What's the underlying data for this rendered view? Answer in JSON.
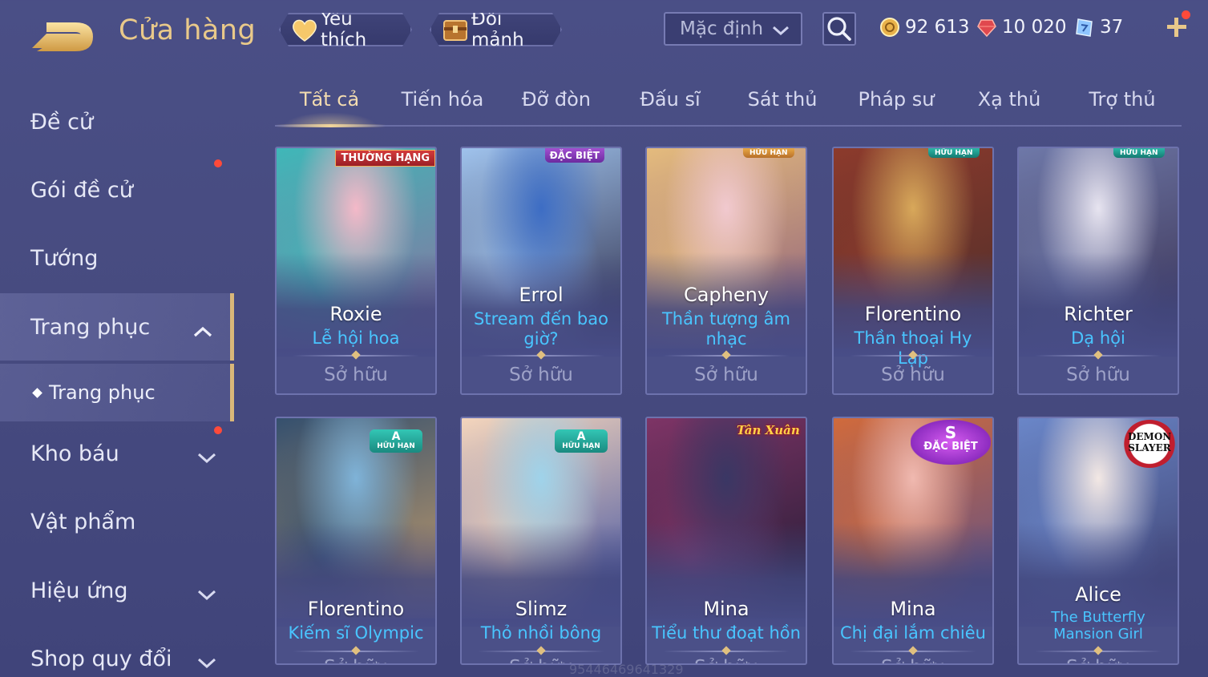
{
  "header": {
    "title": "Cửa hàng",
    "favorites_label": "Yêu thích",
    "fragments_label": "Đổi mảnh",
    "sort_value": "Mặc định",
    "currency": {
      "gold": "92 613",
      "ruby": "10 020",
      "voucher": "37"
    }
  },
  "sidebar": {
    "items": [
      {
        "label": "Đề cử",
        "arrow": "none",
        "badge": false
      },
      {
        "label": "Gói đề cử",
        "arrow": "none",
        "badge": true
      },
      {
        "label": "Tướng",
        "arrow": "none",
        "badge": false
      },
      {
        "label": "Trang phục",
        "arrow": "up",
        "badge": false,
        "active": true
      },
      {
        "label": "Trang phục",
        "sub": true,
        "active": true
      },
      {
        "label": "Kho báu",
        "arrow": "down",
        "badge": true
      },
      {
        "label": "Vật phẩm",
        "arrow": "none",
        "badge": false
      },
      {
        "label": "Hiệu ứng",
        "arrow": "down",
        "badge": false
      },
      {
        "label": "Shop quy đổi",
        "arrow": "down",
        "badge": false
      }
    ]
  },
  "tabs": [
    "Tất cả",
    "Tiến hóa",
    "Đỡ đòn",
    "Đấu sĩ",
    "Sát thủ",
    "Pháp sư",
    "Xạ thủ",
    "Trợ thủ"
  ],
  "active_tab": 0,
  "cards": [
    {
      "hero": "Roxie",
      "skin": "Lễ hội hoa",
      "status": "Sở hữu",
      "badge": "THƯỜNG HẠNG",
      "badge_type": "red",
      "colors": [
        "#f4b9c8",
        "#3fb7b8",
        "#8e6f9e"
      ]
    },
    {
      "hero": "Errol",
      "skin": "Stream đến bao giờ?",
      "status": "Sở hữu",
      "badge": "ĐẶC BIỆT",
      "badge_type": "purple",
      "colors": [
        "#3d6dc4",
        "#9fc2ec",
        "#2d2c48"
      ]
    },
    {
      "hero": "Capheny",
      "skin": "Thần tượng âm nhạc",
      "status": "Sở hữu",
      "badge": "HỮU HẠN",
      "badge_type": "gold",
      "colors": [
        "#f1c9cf",
        "#e4bb7d",
        "#8a5b7c"
      ]
    },
    {
      "hero": "Florentino",
      "skin": "Thần thoại Hy Lạp",
      "status": "Sở hữu",
      "badge": "HỮU HẠN",
      "badge_type": "teal",
      "colors": [
        "#d8a85a",
        "#8c3a2c",
        "#4d2e2a"
      ]
    },
    {
      "hero": "Richter",
      "skin": "Dạ hội",
      "status": "Sở hữu",
      "badge": "HỮU HẠN",
      "badge_type": "teal",
      "colors": [
        "#e7e4f0",
        "#6e78a8",
        "#3a3152"
      ]
    },
    {
      "hero": "Florentino",
      "skin": "Kiếm sĩ Olympic",
      "status": "Sở hữu",
      "badge": "HỮU HẠN",
      "badge_level": "A",
      "badge_type": "teal2",
      "colors": [
        "#7fb3d8",
        "#35506e",
        "#c99f6a"
      ]
    },
    {
      "hero": "Slimz",
      "skin": "Thỏ nhồi bông",
      "status": "Sở hữu",
      "badge": "HỮU HẠN",
      "badge_level": "A",
      "badge_type": "teal2",
      "colors": [
        "#9fd3ea",
        "#f4d5bc",
        "#3c4ea0"
      ]
    },
    {
      "hero": "Mina",
      "skin": "Tiểu thư đoạt hồn",
      "status": "Sở hữu",
      "badge": "Tân Xuân",
      "badge_type": "tan",
      "colors": [
        "#3a3764",
        "#7e3466",
        "#1f1b33"
      ]
    },
    {
      "hero": "Mina",
      "skin": "Chị đại lắm chiêu",
      "status": "Sở hữu",
      "badge": "ĐẶC BIỆT",
      "badge_level": "S",
      "badge_type": "s",
      "colors": [
        "#f0b9b0",
        "#d06a3c",
        "#5a4f8a"
      ]
    },
    {
      "hero": "Alice",
      "skin": "The Butterfly Mansion Girl",
      "status": "Sở hữu",
      "badge": "DEMON SLAYER",
      "badge_type": "demon",
      "colors": [
        "#f3e8e4",
        "#6a86c8",
        "#3d3f6e"
      ]
    }
  ],
  "watermark": "95446469641329"
}
